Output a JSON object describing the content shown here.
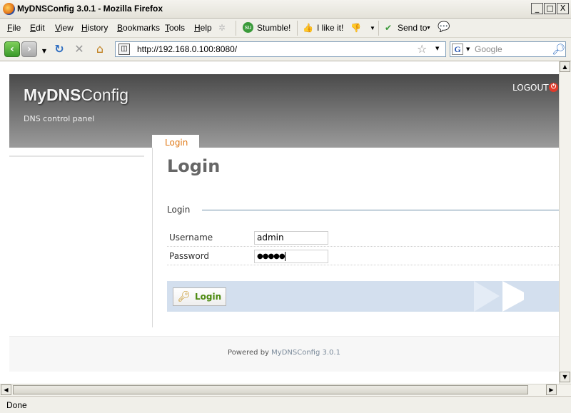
{
  "window": {
    "title": "MyDNSConfig 3.0.1 - Mozilla Firefox",
    "min": "_",
    "max": "□",
    "close": "X"
  },
  "menu": {
    "items": [
      "File",
      "Edit",
      "View",
      "History",
      "Bookmarks",
      "Tools",
      "Help"
    ],
    "stumble": "Stumble!",
    "ilike": "I like it!",
    "sendto": "Send to"
  },
  "nav": {
    "url": "http://192.168.0.100:8080/",
    "search_placeholder": "Google",
    "search_engine": "G"
  },
  "page": {
    "brand_bold": "MyDNS",
    "brand_rest": "Config",
    "brand_sub": "DNS control panel",
    "logout": "LOGOUT",
    "tab": "Login",
    "title": "Login",
    "legend": "Login",
    "username_label": "Username",
    "username_value": "admin",
    "password_label": "Password",
    "password_value": "●●●●●",
    "login_button": "Login",
    "footer_prefix": "Powered by",
    "footer_link": "MyDNSConfig 3.0.1"
  },
  "status": {
    "text": "Done"
  },
  "colors": {
    "tab_accent": "#e07a18",
    "button_text": "#4c8a10",
    "button_band": "#d3dfee"
  }
}
